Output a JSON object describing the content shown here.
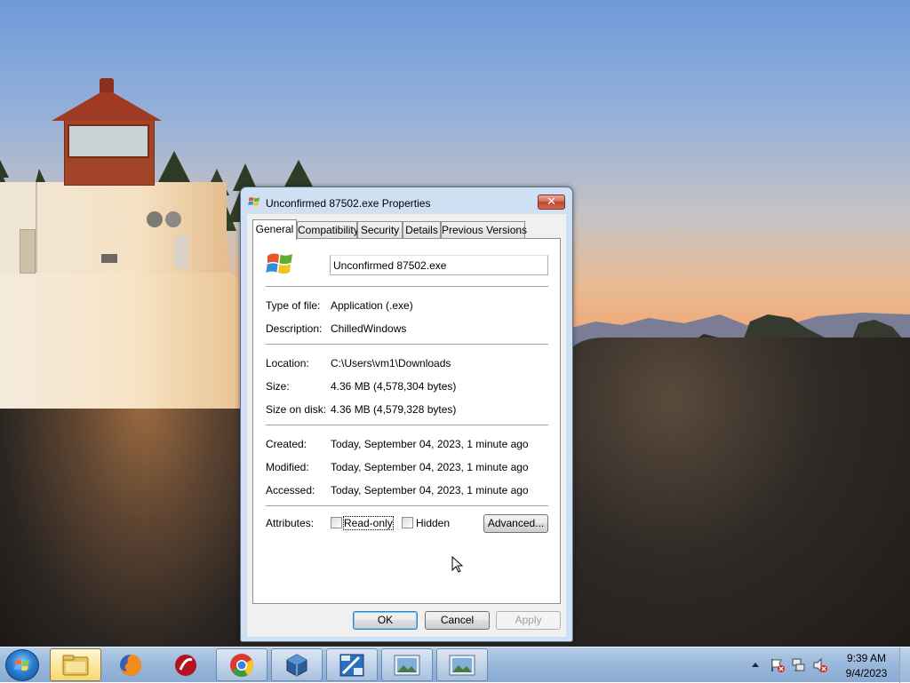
{
  "dialog": {
    "title": "Unconfirmed 87502.exe Properties",
    "close_label": "✕",
    "tabs": [
      "General",
      "Compatibility",
      "Security",
      "Details",
      "Previous Versions"
    ],
    "active_tab": "General",
    "filename": "Unconfirmed 87502.exe",
    "fields": {
      "type_of_file": {
        "label": "Type of file:",
        "value": "Application (.exe)"
      },
      "description": {
        "label": "Description:",
        "value": "ChilledWindows"
      },
      "location": {
        "label": "Location:",
        "value": "C:\\Users\\vm1\\Downloads"
      },
      "size": {
        "label": "Size:",
        "value": "4.36 MB (4,578,304 bytes)"
      },
      "size_on_disk": {
        "label": "Size on disk:",
        "value": "4.36 MB (4,579,328 bytes)"
      },
      "created": {
        "label": "Created:",
        "value": "Today, September 04, 2023, 1 minute ago"
      },
      "modified": {
        "label": "Modified:",
        "value": "Today, September 04, 2023, 1 minute ago"
      },
      "accessed": {
        "label": "Accessed:",
        "value": "Today, September 04, 2023, 1 minute ago"
      }
    },
    "attributes": {
      "label": "Attributes:",
      "read_only": "Read-only",
      "hidden": "Hidden",
      "advanced": "Advanced..."
    },
    "buttons": {
      "ok": "OK",
      "cancel": "Cancel",
      "apply": "Apply"
    }
  },
  "taskbar": {
    "items": [
      "start",
      "windows-explorer",
      "firefox",
      "app-red",
      "chrome",
      "virtualbox",
      "xp-mode",
      "image-viewer-1",
      "image-viewer-2"
    ],
    "clock": {
      "time": "9:39 AM",
      "date": "9/4/2023"
    }
  },
  "colors": {
    "accent": "#3c7fb1",
    "taskbar": "#9bb9dc",
    "close": "#c0452c"
  }
}
